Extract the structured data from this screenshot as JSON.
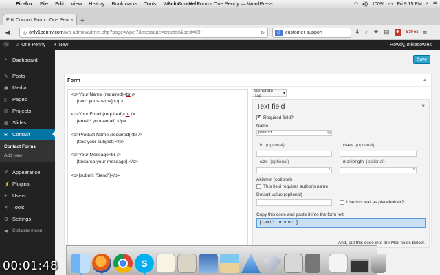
{
  "mac_menubar": {
    "app": "Firefox",
    "menus": [
      "File",
      "Edit",
      "View",
      "History",
      "Bookmarks",
      "Tools",
      "Window",
      "Help"
    ],
    "window_title": "Edit Contact Form ‹ One Penny — WordPress",
    "battery": "100%",
    "clock": "Fri 9:15 PM"
  },
  "browser": {
    "tab_title": "Edit Contact Form ‹ One Penny",
    "new_tab": "+",
    "url_host": "only1penny.com",
    "url_path": "/wp-admin/admin.php?page=wpcf7&message=created&post=89",
    "search_engine_icon": "G",
    "search_value": "customer support"
  },
  "wp_admin_bar": {
    "site_name": "One Penny",
    "new_label": "New",
    "howdy": "Howdy, mikecowles"
  },
  "sidebar": {
    "items": [
      {
        "label": "Dashboard",
        "icon": "dashboard-icon"
      },
      {
        "label": "Posts",
        "icon": "pin-icon"
      },
      {
        "label": "Media",
        "icon": "media-icon"
      },
      {
        "label": "Pages",
        "icon": "page-icon"
      },
      {
        "label": "Projects",
        "icon": "projects-icon"
      },
      {
        "label": "Slides",
        "icon": "slides-icon"
      },
      {
        "label": "Contact",
        "icon": "mail-icon"
      }
    ],
    "contact_sub": [
      "Contact Forms",
      "Add New"
    ],
    "items2": [
      {
        "label": "Appearance",
        "icon": "brush-icon"
      },
      {
        "label": "Plugins",
        "icon": "plug-icon"
      },
      {
        "label": "Users",
        "icon": "user-icon"
      },
      {
        "label": "Tools",
        "icon": "wrench-icon"
      },
      {
        "label": "Settings",
        "icon": "settings-icon"
      }
    ],
    "collapse": "Collapse menu"
  },
  "main": {
    "save_label": "Save",
    "form_title": "Form",
    "editor": {
      "l1a": "<p>Your Name (required)<",
      "l1b": "br",
      "l1c": " />",
      "l2": "[text* your-name] </p>",
      "l3a": "<p>Your Email (required)<",
      "l3b": "br",
      "l3c": " />",
      "l4": "[email* your-email] </p>",
      "l5a": "<p>Product Name (required)<",
      "l5b": "br",
      "l5c": " />",
      "l6": "[text your-subject] </p>",
      "l7a": "<p>Your Message<",
      "l7b": "br",
      "l7c": " />",
      "l8a": "[",
      "l8b": "textarea",
      "l8c": " your-message] </p>",
      "l9": "<p>[submit \"Send\"]</p>"
    },
    "generate_tag": "Generate Tag",
    "tag_panel": {
      "title": "Text field",
      "close": "×",
      "required_label": "Required field?",
      "required_checked": true,
      "name_label": "Name",
      "name_value": "product",
      "id_label": "id",
      "class_label": "class",
      "size_label": "size",
      "maxlength_label": "maxlength",
      "optional": "(optional)",
      "akismet_label": "Akismet (optional)",
      "akismet_option": "This field requires author's name",
      "default_label": "Default value (optional)",
      "placeholder_option": "Use this text as placeholder?",
      "copy_label": "Copy this code and paste it into the form left.",
      "code_before": "[text* pr",
      "code_after": "oduct]",
      "mail_note": "And, put this code into the Mail fields below."
    }
  },
  "dock": {
    "apps": [
      "finder",
      "firefox",
      "chrome",
      "skype",
      "notes",
      "preview",
      "photo",
      "beach",
      "mail",
      "sketch",
      "calc",
      "ipod",
      "doc",
      "screen",
      "trash"
    ]
  },
  "video_timer": "00:01:48"
}
